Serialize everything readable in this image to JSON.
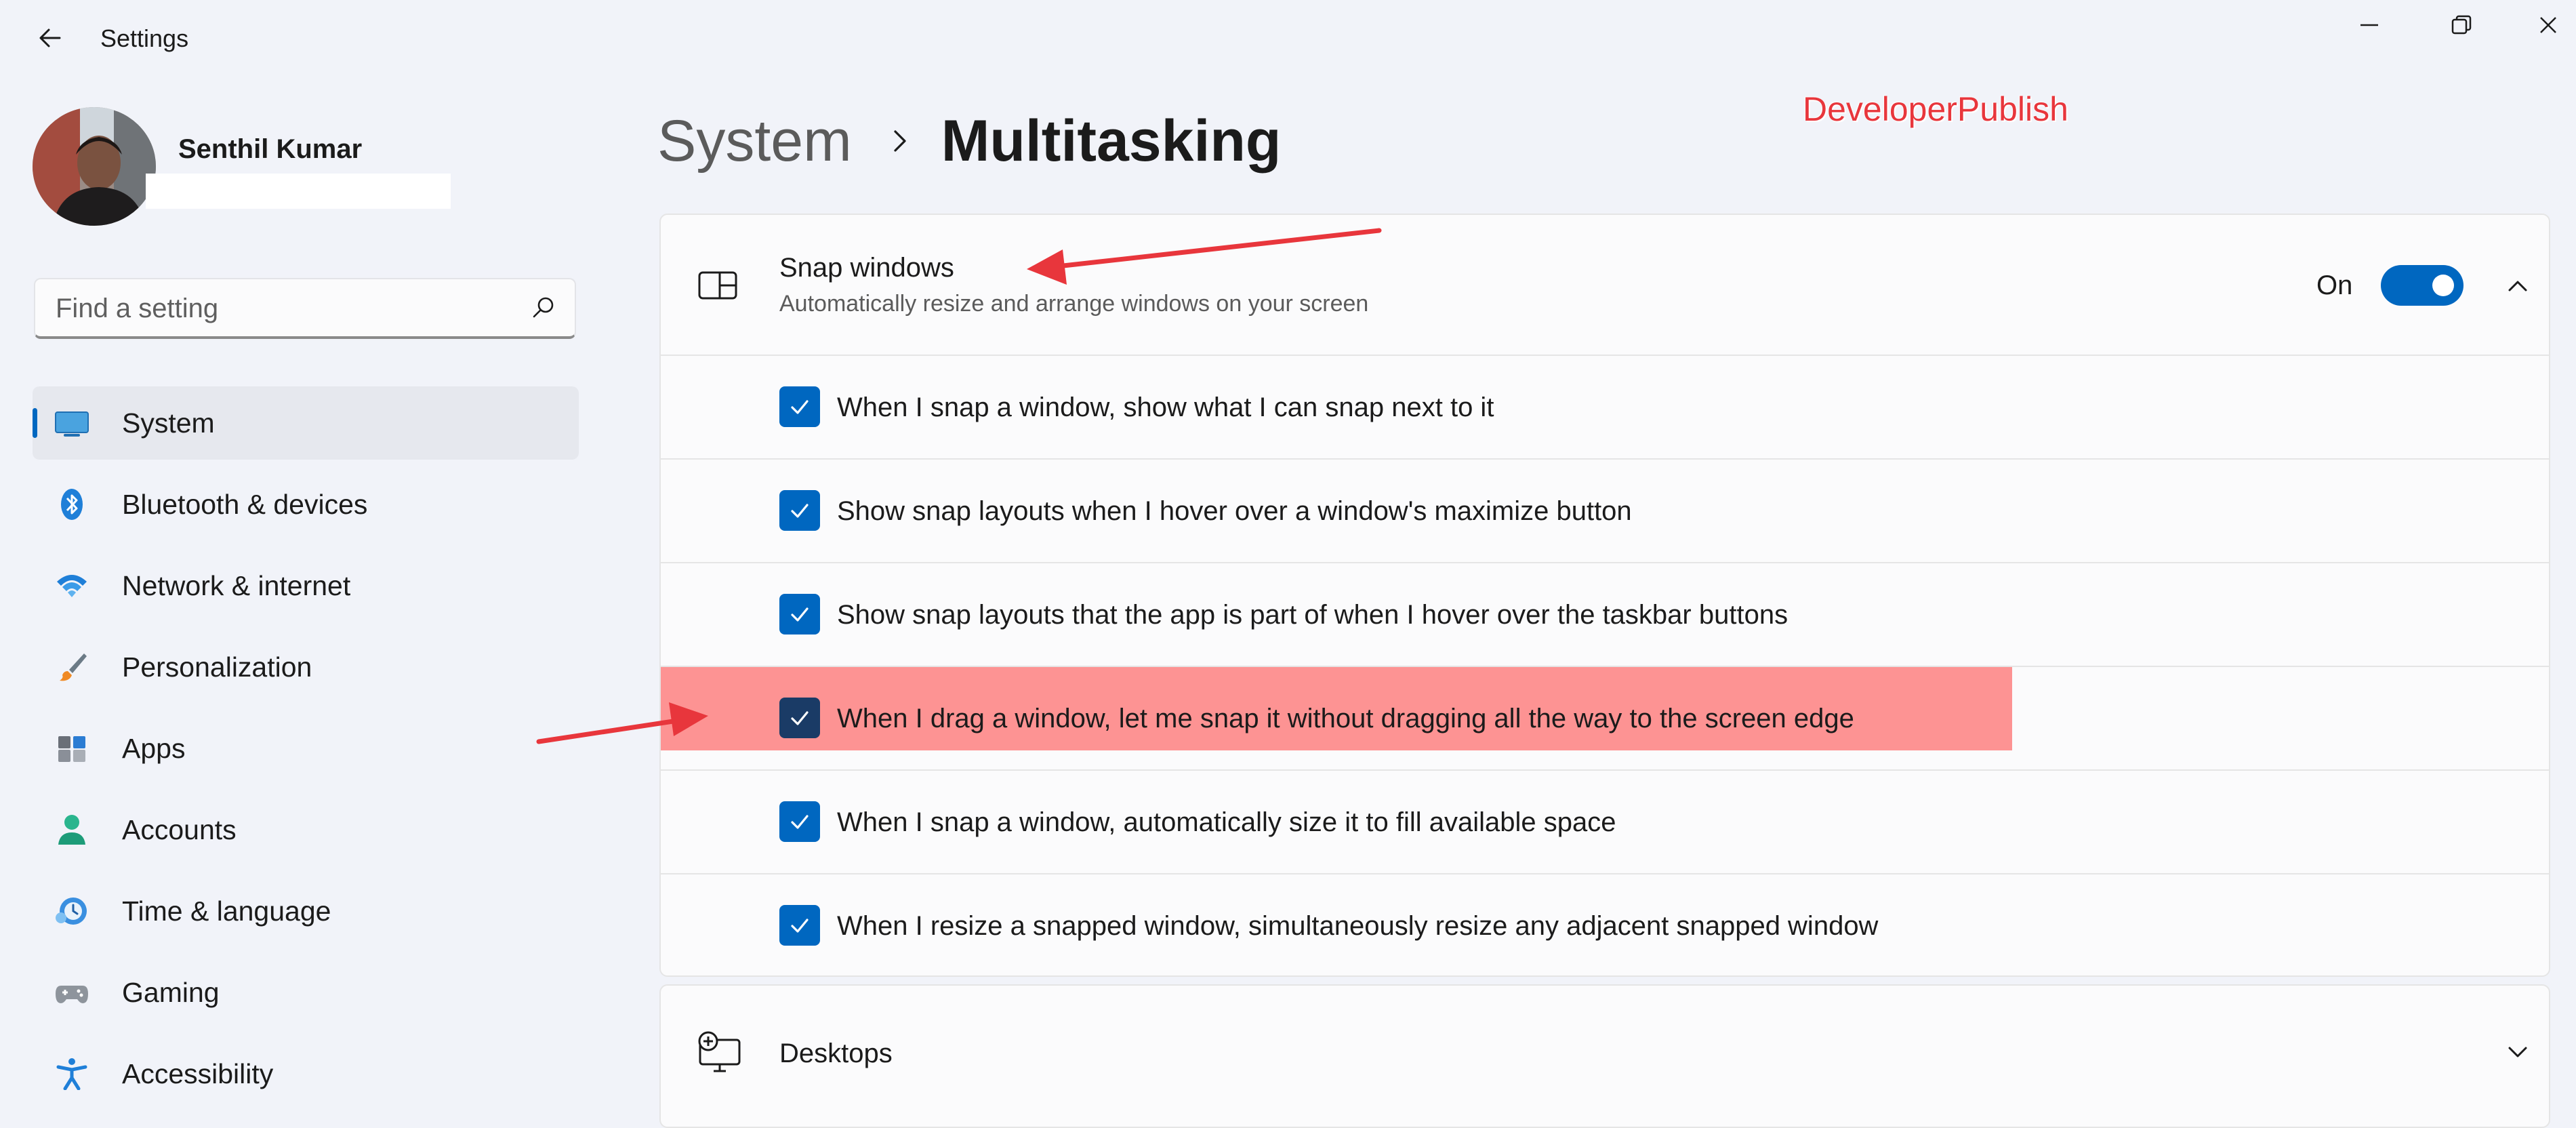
{
  "titlebar": {
    "title": "Settings",
    "back_icon": "arrow-left-icon",
    "controls": [
      "minimize-icon",
      "restore-icon",
      "close-icon"
    ]
  },
  "profile": {
    "name": "Senthil Kumar"
  },
  "search": {
    "placeholder": "Find a setting",
    "icon": "search-icon"
  },
  "sidebar": {
    "selected": "System",
    "items": [
      {
        "label": "System",
        "icon": "monitor-icon"
      },
      {
        "label": "Bluetooth & devices",
        "icon": "bluetooth-icon"
      },
      {
        "label": "Network & internet",
        "icon": "wifi-icon"
      },
      {
        "label": "Personalization",
        "icon": "paintbrush-icon"
      },
      {
        "label": "Apps",
        "icon": "apps-icon"
      },
      {
        "label": "Accounts",
        "icon": "person-icon"
      },
      {
        "label": "Time & language",
        "icon": "clock-globe-icon"
      },
      {
        "label": "Gaming",
        "icon": "gamepad-icon"
      },
      {
        "label": "Accessibility",
        "icon": "accessibility-icon"
      }
    ]
  },
  "header": {
    "parent": "System",
    "current": "Multitasking"
  },
  "watermark": "DeveloperPublish",
  "snap": {
    "title": "Snap windows",
    "description": "Automatically resize and arrange windows on your screen",
    "toggle_label": "On",
    "toggle_on": true,
    "expanded": true,
    "options": [
      {
        "label": "When I snap a window, show what I can snap next to it",
        "checked": true
      },
      {
        "label": "Show snap layouts when I hover over a window's maximize button",
        "checked": true
      },
      {
        "label": "Show snap layouts that the app is part of when I hover over the taskbar buttons",
        "checked": true
      },
      {
        "label": "When I drag a window, let me snap it without dragging all the way to the screen edge",
        "checked": true,
        "highlighted": true
      },
      {
        "label": "When I snap a window, automatically size it to fill available space",
        "checked": true
      },
      {
        "label": "When I resize a snapped window, simultaneously resize any adjacent snapped window",
        "checked": true
      }
    ]
  },
  "desktops": {
    "title": "Desktops",
    "expanded": false
  },
  "colors": {
    "accent": "#0067c0",
    "background": "#f1f3f9",
    "card": "#fbfbfc",
    "highlight": "#fd9393",
    "annotation": "#e8363c"
  }
}
